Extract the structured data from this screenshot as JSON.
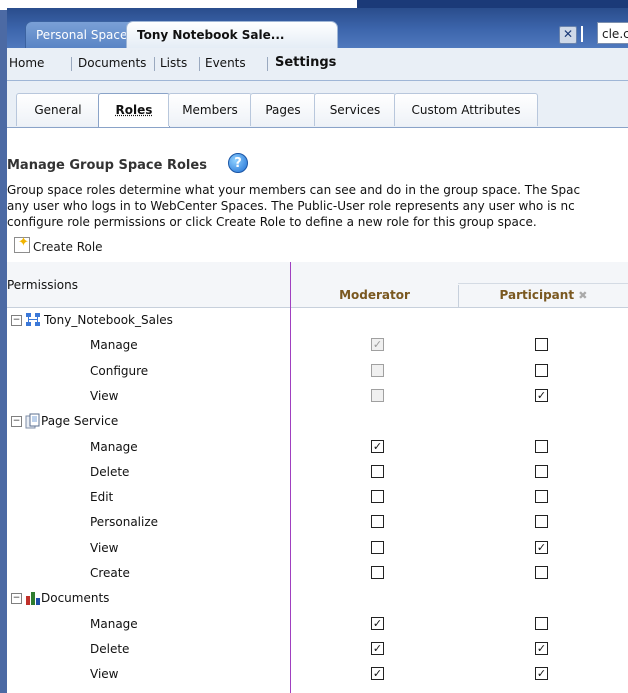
{
  "tabs": [
    {
      "label": "Personal Space"
    },
    {
      "label": "Tony Notebook Sale..."
    }
  ],
  "search": {
    "value": "cle.c"
  },
  "nav": {
    "items": [
      "Home",
      "Documents",
      "Lists",
      "Events",
      "Settings"
    ]
  },
  "subtabs": [
    "General",
    "Roles",
    "Members",
    "Pages",
    "Services",
    "Custom Attributes"
  ],
  "page": {
    "title": "Manage Group Space Roles",
    "description": [
      "Group space roles determine what your members can see and do in the group space. The Spac",
      "any user who logs in to WebCenter Spaces. The Public-User role represents any user who is nc",
      "configure role permissions or click Create Role to define a new role for this group space."
    ],
    "create_role_label": "Create Role"
  },
  "table": {
    "permissions_header": "Permissions",
    "columns": [
      "Moderator",
      "Participant"
    ],
    "groups": [
      {
        "name": "Tony_Notebook_Sales",
        "icon": "group-space-icon",
        "rows": [
          {
            "label": "Manage",
            "moderator": "checked-disabled",
            "participant": "unchecked"
          },
          {
            "label": "Configure",
            "moderator": "unchecked-disabled",
            "participant": "unchecked"
          },
          {
            "label": "View",
            "moderator": "unchecked-disabled",
            "participant": "checked"
          }
        ]
      },
      {
        "name": "Page Service",
        "icon": "page-service-icon",
        "rows": [
          {
            "label": "Manage",
            "moderator": "checked",
            "participant": "unchecked"
          },
          {
            "label": "Delete",
            "moderator": "unchecked",
            "participant": "unchecked"
          },
          {
            "label": "Edit",
            "moderator": "unchecked",
            "participant": "unchecked"
          },
          {
            "label": "Personalize",
            "moderator": "unchecked",
            "participant": "unchecked"
          },
          {
            "label": "View",
            "moderator": "unchecked",
            "participant": "checked"
          },
          {
            "label": "Create",
            "moderator": "unchecked",
            "participant": "unchecked"
          }
        ]
      },
      {
        "name": "Documents",
        "icon": "documents-icon",
        "rows": [
          {
            "label": "Manage",
            "moderator": "checked",
            "participant": "unchecked"
          },
          {
            "label": "Delete",
            "moderator": "checked",
            "participant": "checked"
          },
          {
            "label": "View",
            "moderator": "checked",
            "participant": "checked"
          }
        ]
      }
    ]
  }
}
